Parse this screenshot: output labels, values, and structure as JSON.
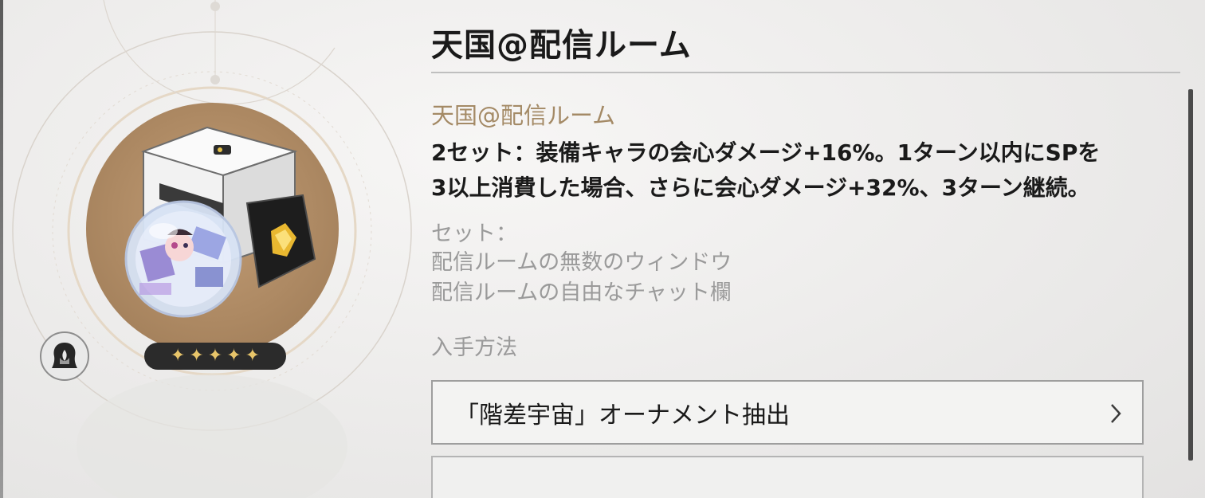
{
  "relic": {
    "title": "天国@配信ルーム",
    "set_name": "天国@配信ルーム",
    "set_effect_line1": "2セット：装備キャラの会心ダメージ+16%。1ターン以内にSPを",
    "set_effect_line2": "3以上消費した場合、さらに会心ダメージ+32%、3ターン継続。",
    "pieces_label": "セット：",
    "pieces": [
      "配信ルームの無数のウィンドウ",
      "配信ルームの自由なチャット欄"
    ],
    "rarity_stars": 5,
    "star_glyph": "✦",
    "path_icon": "path-emblem-icon"
  },
  "obtain": {
    "label": "入手方法",
    "sources": [
      "「階差宇宙」オーナメント抽出"
    ]
  },
  "colors": {
    "set_name": "#a48a66",
    "star": "#e8c56a",
    "disc": "#ad8963"
  }
}
